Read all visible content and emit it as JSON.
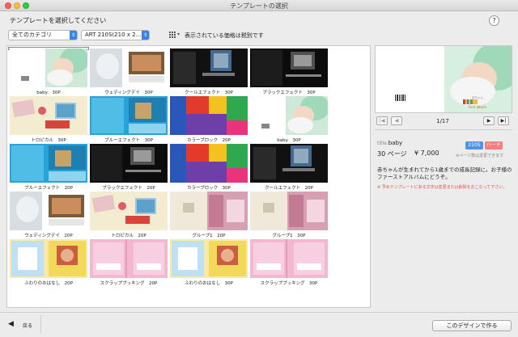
{
  "window": {
    "title": "テンプレートの選択"
  },
  "prompt": "テンプレートを選択してください",
  "filters": {
    "category": "全てのカテゴリ",
    "size": "ART 210S(210 x 2...",
    "price_note": "表示されている価格は税別です",
    "help": "?"
  },
  "templates": [
    {
      "label": "baby　30P",
      "style": "baby"
    },
    {
      "label": "ウェディングデイ　30P",
      "style": "wedding"
    },
    {
      "label": "クールエフェクト　30P",
      "style": "cool"
    },
    {
      "label": "ブラックエフェクト　30P",
      "style": "black"
    },
    {
      "label": "トロピカル　30P",
      "style": "tropical"
    },
    {
      "label": "ブルーエフェクト　30P",
      "style": "blue"
    },
    {
      "label": "カラーブロック　20P",
      "style": "colorblock"
    },
    {
      "label": "baby　30P",
      "style": "baby"
    },
    {
      "label": "ブルーエフェクト　20P",
      "style": "blue"
    },
    {
      "label": "ブラックエフェクト　20P",
      "style": "black"
    },
    {
      "label": "カラーブロック　30P",
      "style": "colorblock"
    },
    {
      "label": "クールエフェクト　20P",
      "style": "cool"
    },
    {
      "label": "ウェディングデイ　20P",
      "style": "wedding"
    },
    {
      "label": "トロピカル　20P",
      "style": "tropical"
    },
    {
      "label": "グループ1　20P",
      "style": "group"
    },
    {
      "label": "グループ1　30P",
      "style": "group"
    },
    {
      "label": "ふわりのおはなし　20P",
      "style": "fuwari"
    },
    {
      "label": "スクラップブッキング　20P",
      "style": "scrap"
    },
    {
      "label": "ふわりのおはなし　30P",
      "style": "fuwari"
    },
    {
      "label": "スクラップブッキング　30P",
      "style": "scrap"
    }
  ],
  "preview": {
    "album_text": "First album",
    "album_sub": "赤ちゃん",
    "page_counter": "1/17",
    "nav": {
      "first": "|◀",
      "prev": "◀",
      "next": "▶",
      "last": "▶|"
    }
  },
  "info": {
    "title_key": "title:",
    "title_value": "baby",
    "size_badge": "210S",
    "cover_badge": "ハード",
    "pages": "30 ページ",
    "price": "¥ 7,000",
    "tax_note": "※ページ数は変更できます",
    "description": "赤ちゃんが生まれてから1歳までの成長記録に。お子様のファーストアルバムにどうぞ。",
    "notice": "※ 予めテンプレートにある文字は変更または削除をおこなって下さい。"
  },
  "footer": {
    "back_icon": "◀",
    "back_label": "戻る",
    "go_button": "このデザインで作る"
  },
  "colors": {
    "accent_blue": "#3b82e6",
    "badge_blue": "#4b94e8",
    "badge_red": "#f27e7e",
    "notice_red": "#e0534f"
  }
}
